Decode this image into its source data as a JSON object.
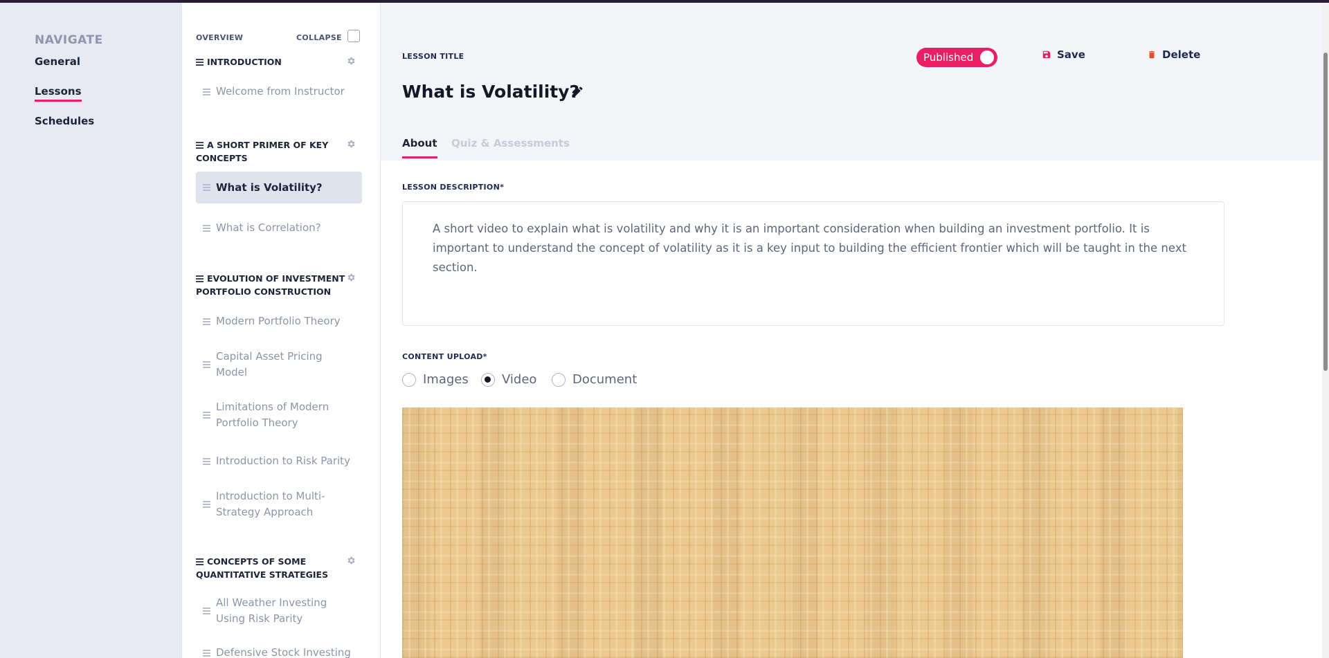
{
  "nav": {
    "heading": "NAVIGATE",
    "items": [
      {
        "label": "General"
      },
      {
        "label": "Lessons"
      },
      {
        "label": "Schedules"
      }
    ]
  },
  "outline": {
    "overview_label": "OVERVIEW",
    "collapse_label": "COLLAPSE",
    "sections": [
      {
        "title": "INTRODUCTION",
        "lessons": [
          "Welcome from Instructor"
        ]
      },
      {
        "title": "A SHORT PRIMER OF KEY CONCEPTS",
        "lessons": [
          "What is Volatility?",
          "What is Correlation?"
        ]
      },
      {
        "title": "EVOLUTION OF INVESTMENT PORTFOLIO CONSTRUCTION",
        "lessons": [
          "Modern Portfolio Theory",
          "Capital Asset Pricing Model",
          "Limitations of Modern Portfolio Theory",
          "Introduction to Risk Parity",
          "Introduction to Multi-Strategy Approach"
        ]
      },
      {
        "title": "CONCEPTS OF SOME QUANTITATIVE STRATEGIES",
        "lessons": [
          "All Weather Investing Using Risk Parity",
          "Defensive Stock Investing"
        ]
      }
    ]
  },
  "lesson": {
    "title_label": "LESSON TITLE",
    "title": "What is Volatility?",
    "status": "Published",
    "save_label": "Save",
    "delete_label": "Delete",
    "tabs": [
      {
        "label": "About"
      },
      {
        "label": "Quiz & Assessments"
      }
    ],
    "description_label": "LESSON DESCRIPTION*",
    "description": "A short video to explain what is volatility and why it is an important consideration when building an investment portfolio. It is important to understand the concept of volatility as it is a key input to building the efficient frontier which will be taught in the next section.",
    "upload_label": "CONTENT UPLOAD*",
    "upload_options": [
      {
        "label": "Images",
        "checked": false
      },
      {
        "label": "Video",
        "checked": true
      },
      {
        "label": "Document",
        "checked": false
      }
    ]
  },
  "colors": {
    "accent": "#e91e63",
    "nav_bg": "#e7eaf3",
    "header_bg": "#f4f5f8",
    "text_dark": "#1c2438"
  }
}
